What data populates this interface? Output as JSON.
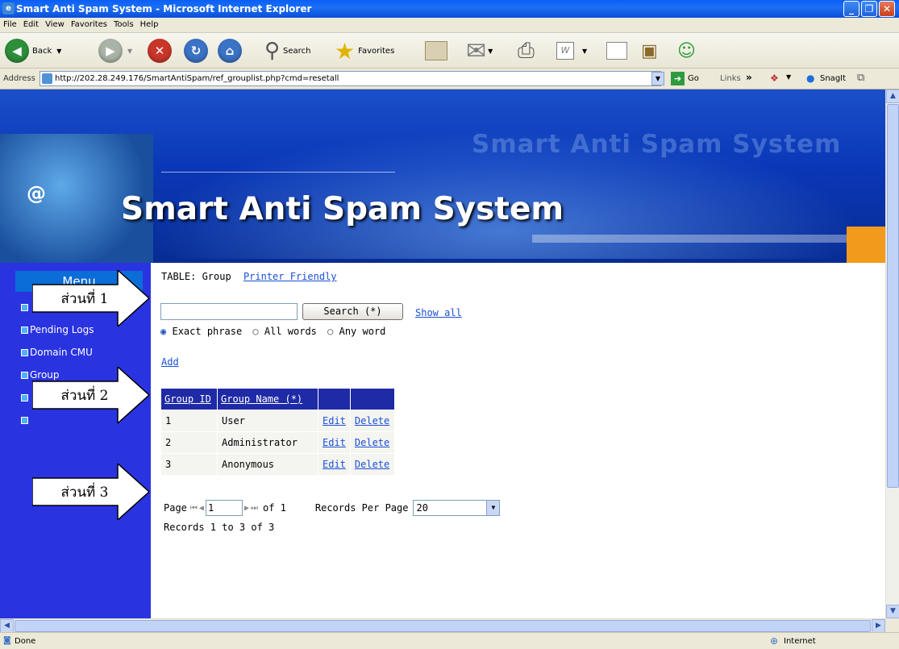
{
  "window": {
    "title": "Smart Anti Spam System - Microsoft Internet Explorer",
    "menu": [
      "File",
      "Edit",
      "View",
      "Favorites",
      "Tools",
      "Help"
    ]
  },
  "toolbar": {
    "back": "Back",
    "search": "Search",
    "favorites": "Favorites"
  },
  "address": {
    "label": "Address",
    "url": "http://202.28.249.176/SmartAntiSpam/ref_grouplist.php?cmd=resetall",
    "go": "Go",
    "links": "Links",
    "links_chev": "»",
    "snagit": "SnagIt"
  },
  "banner": {
    "title": "Smart Anti Spam System",
    "ghost_title": "Smart Anti Spam System",
    "logo_at": "@"
  },
  "sidebar": {
    "header": "Menu",
    "items": [
      "Pending Logs",
      "Domain CMU",
      "Group"
    ]
  },
  "annotations": [
    "ส่วนที่ 1",
    "ส่วนที่ 2",
    "ส่วนที่ 3"
  ],
  "page": {
    "table_label": "TABLE: Group",
    "printer_friendly": "Printer Friendly",
    "search_button": "Search (*)",
    "show_all": "Show all",
    "search_value": "",
    "radios": [
      "Exact phrase",
      "All words",
      "Any word"
    ],
    "add": "Add",
    "columns": [
      "Group ID",
      "Group Name (*)"
    ],
    "rows": [
      {
        "id": "1",
        "name": "User",
        "edit": "Edit",
        "delete": "Delete"
      },
      {
        "id": "2",
        "name": "Administrator",
        "edit": "Edit",
        "delete": "Delete"
      },
      {
        "id": "3",
        "name": "Anonymous",
        "edit": "Edit",
        "delete": "Delete"
      }
    ],
    "pager": {
      "page_label": "Page",
      "page_value": "1",
      "of": "of 1",
      "rpp_label": "Records Per Page",
      "rpp_value": "20",
      "records": "Records 1 to 3 of 3"
    }
  },
  "status": {
    "left": "Done",
    "right": "Internet"
  }
}
